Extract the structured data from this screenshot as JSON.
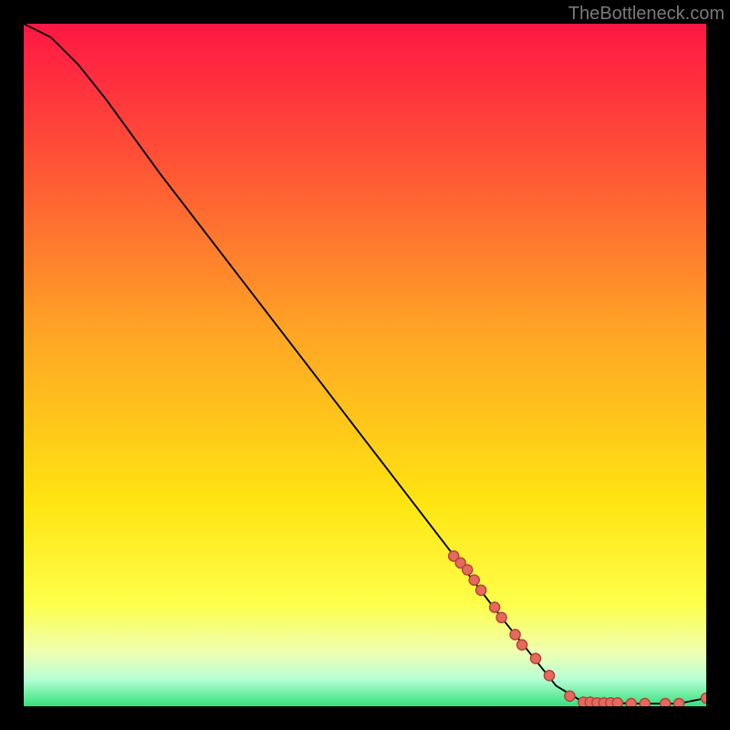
{
  "watermark": "TheBottleneck.com",
  "colors": {
    "gradient": [
      {
        "offset": "0%",
        "color": "#ff1744"
      },
      {
        "offset": "20%",
        "color": "#ff5236"
      },
      {
        "offset": "45%",
        "color": "#ffa425"
      },
      {
        "offset": "70%",
        "color": "#ffe411"
      },
      {
        "offset": "85%",
        "color": "#fdff4a"
      },
      {
        "offset": "92%",
        "color": "#efffb0"
      },
      {
        "offset": "96%",
        "color": "#b7ffd5"
      },
      {
        "offset": "100%",
        "color": "#35e07a"
      }
    ],
    "curve": "#000000",
    "marker_fill": "#e36a5c",
    "marker_stroke": "#b04038"
  },
  "chart_data": {
    "type": "line",
    "title": "",
    "xlabel": "",
    "ylabel": "",
    "xlim": [
      0,
      100
    ],
    "ylim": [
      0,
      100
    ],
    "note": "x/y are normalized percentages of the plot area (0–100). y represents bottleneck percentage (high=red, low=green).",
    "curve": [
      {
        "x": 0,
        "y": 100
      },
      {
        "x": 4,
        "y": 98
      },
      {
        "x": 8,
        "y": 94
      },
      {
        "x": 12,
        "y": 89
      },
      {
        "x": 20,
        "y": 78
      },
      {
        "x": 30,
        "y": 65
      },
      {
        "x": 40,
        "y": 52
      },
      {
        "x": 50,
        "y": 39
      },
      {
        "x": 60,
        "y": 26
      },
      {
        "x": 70,
        "y": 13
      },
      {
        "x": 78,
        "y": 3
      },
      {
        "x": 82,
        "y": 0.6
      },
      {
        "x": 90,
        "y": 0.4
      },
      {
        "x": 96,
        "y": 0.4
      },
      {
        "x": 100,
        "y": 1.2
      }
    ],
    "markers": [
      {
        "x": 63,
        "y": 22
      },
      {
        "x": 64,
        "y": 21
      },
      {
        "x": 65,
        "y": 20
      },
      {
        "x": 66,
        "y": 18.5
      },
      {
        "x": 67,
        "y": 17
      },
      {
        "x": 69,
        "y": 14.5
      },
      {
        "x": 70,
        "y": 13
      },
      {
        "x": 72,
        "y": 10.5
      },
      {
        "x": 73,
        "y": 9
      },
      {
        "x": 75,
        "y": 7
      },
      {
        "x": 77,
        "y": 4.5
      },
      {
        "x": 80,
        "y": 1.5
      },
      {
        "x": 82,
        "y": 0.6
      },
      {
        "x": 83,
        "y": 0.6
      },
      {
        "x": 84,
        "y": 0.5
      },
      {
        "x": 85,
        "y": 0.5
      },
      {
        "x": 86,
        "y": 0.5
      },
      {
        "x": 87,
        "y": 0.5
      },
      {
        "x": 89,
        "y": 0.4
      },
      {
        "x": 91,
        "y": 0.4
      },
      {
        "x": 94,
        "y": 0.4
      },
      {
        "x": 96,
        "y": 0.4
      },
      {
        "x": 100,
        "y": 1.2
      }
    ]
  }
}
